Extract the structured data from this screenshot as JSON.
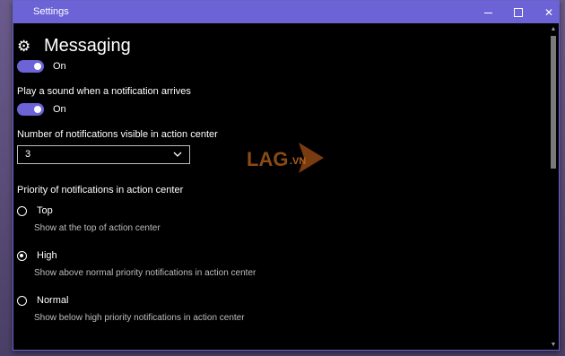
{
  "window": {
    "title": "Settings"
  },
  "header": {
    "title": "Messaging"
  },
  "toggle_top": {
    "state": "On"
  },
  "sound": {
    "label": "Play a sound when a notification arrives",
    "state": "On"
  },
  "visible_count": {
    "label": "Number of notifications visible in action center",
    "value": "3"
  },
  "priority": {
    "label": "Priority of notifications in action center",
    "options": [
      {
        "label": "Top",
        "desc": "Show at the top of action center",
        "checked": false
      },
      {
        "label": "High",
        "desc": "Show above normal priority notifications in action center",
        "checked": true
      },
      {
        "label": "Normal",
        "desc": "Show below high priority notifications in action center",
        "checked": false
      }
    ]
  },
  "watermark": {
    "text": "LAG.VN"
  },
  "colors": {
    "accent": "#6b63d6",
    "background": "#000000"
  }
}
